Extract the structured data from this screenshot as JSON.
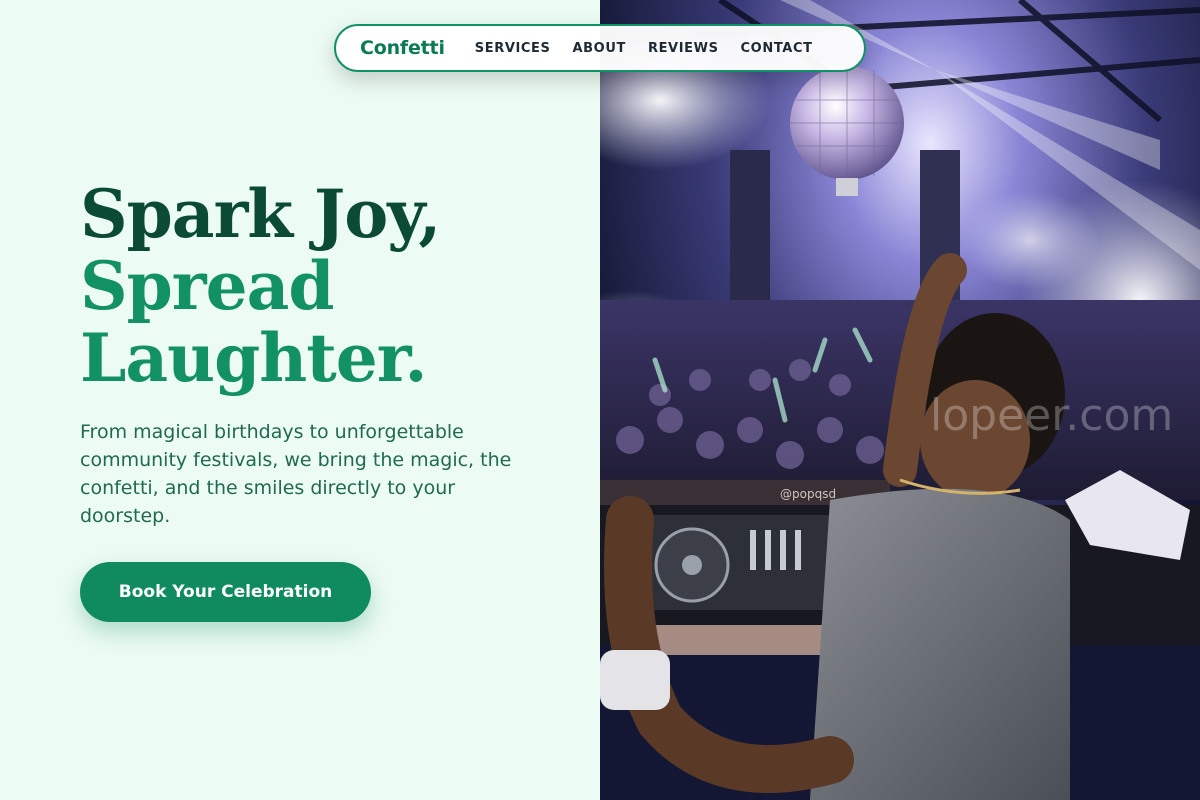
{
  "nav": {
    "brand": "Confetti",
    "links": [
      "SERVICES",
      "ABOUT",
      "REVIEWS",
      "CONTACT"
    ]
  },
  "hero": {
    "headline": [
      "Spark Joy,",
      "Spread",
      "Laughter."
    ],
    "subtext": "From magical birthdays to unforgettable community festivals, we bring the magic, the confetti, and the smiles directly to your doorstep.",
    "cta_label": "Book Your Celebration"
  },
  "photo": {
    "subject": "dj-crowd-party-photo",
    "watermark": "lopeer.com",
    "banner_text": "@popqsd"
  },
  "colors": {
    "background": "#ecfbf3",
    "headline_dark": "#0b4a35",
    "headline_accent": "#129165",
    "body_text": "#1f6a50",
    "primary_button": "#108b5f",
    "nav_border": "#139166"
  }
}
